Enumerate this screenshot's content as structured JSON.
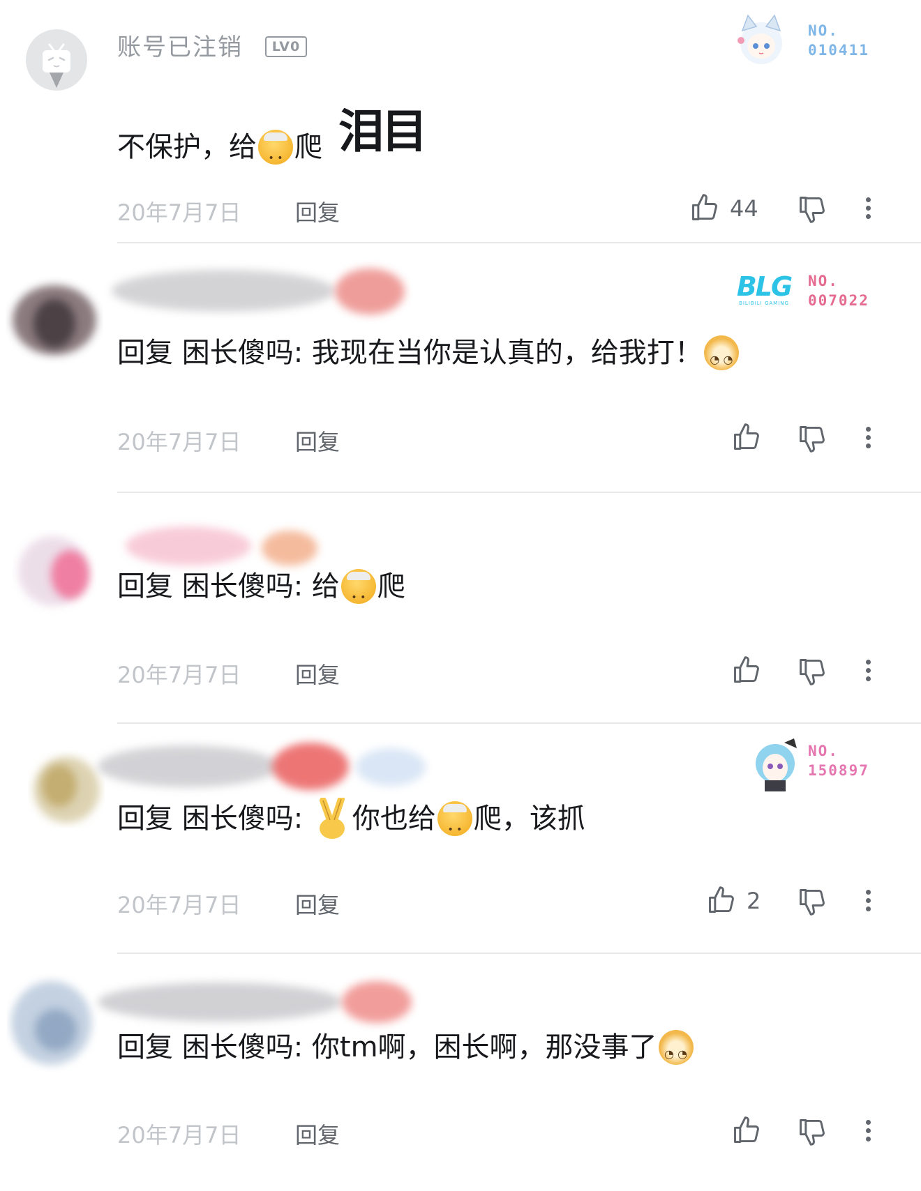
{
  "comments": [
    {
      "username": "账号已注销",
      "level": "LV0",
      "badge_no": "NO.",
      "badge_num": "010411",
      "pre": "不保护，给",
      "mid": "爬",
      "post": "",
      "sticker": "泪目",
      "time": "20年7月7日",
      "reply": "回复",
      "likes": "44",
      "badge_color": "#7fb6e8"
    },
    {
      "badge_no": "NO.",
      "badge_num": "007022",
      "badge_logo": "BLG",
      "badge_logo_sub": "BILIBILI GAMING",
      "pre": "回复 困长傻吗: 我现在当你是认真的，给我打！",
      "time": "20年7月7日",
      "reply": "回复",
      "likes": "",
      "badge_color": "#e56a8f"
    },
    {
      "pre": "回复 困长傻吗: 给",
      "mid": "爬",
      "time": "20年7月7日",
      "reply": "回复",
      "likes": ""
    },
    {
      "badge_no": "NO.",
      "badge_num": "150897",
      "pre": "回复 困长傻吗:",
      "mid": "你也给",
      "post": "爬，该抓",
      "time": "20年7月7日",
      "reply": "回复",
      "likes": "2",
      "badge_color": "#e576b0"
    },
    {
      "pre": "回复 困长傻吗: 你tm啊，困长啊，那没事了",
      "time": "20年7月7日",
      "reply": "回复",
      "likes": ""
    }
  ],
  "icons": {
    "like": "thumbs-up-icon",
    "dislike": "thumbs-down-icon",
    "more": "more-vertical-icon",
    "default_avatar": "bilibili-tv-icon"
  }
}
